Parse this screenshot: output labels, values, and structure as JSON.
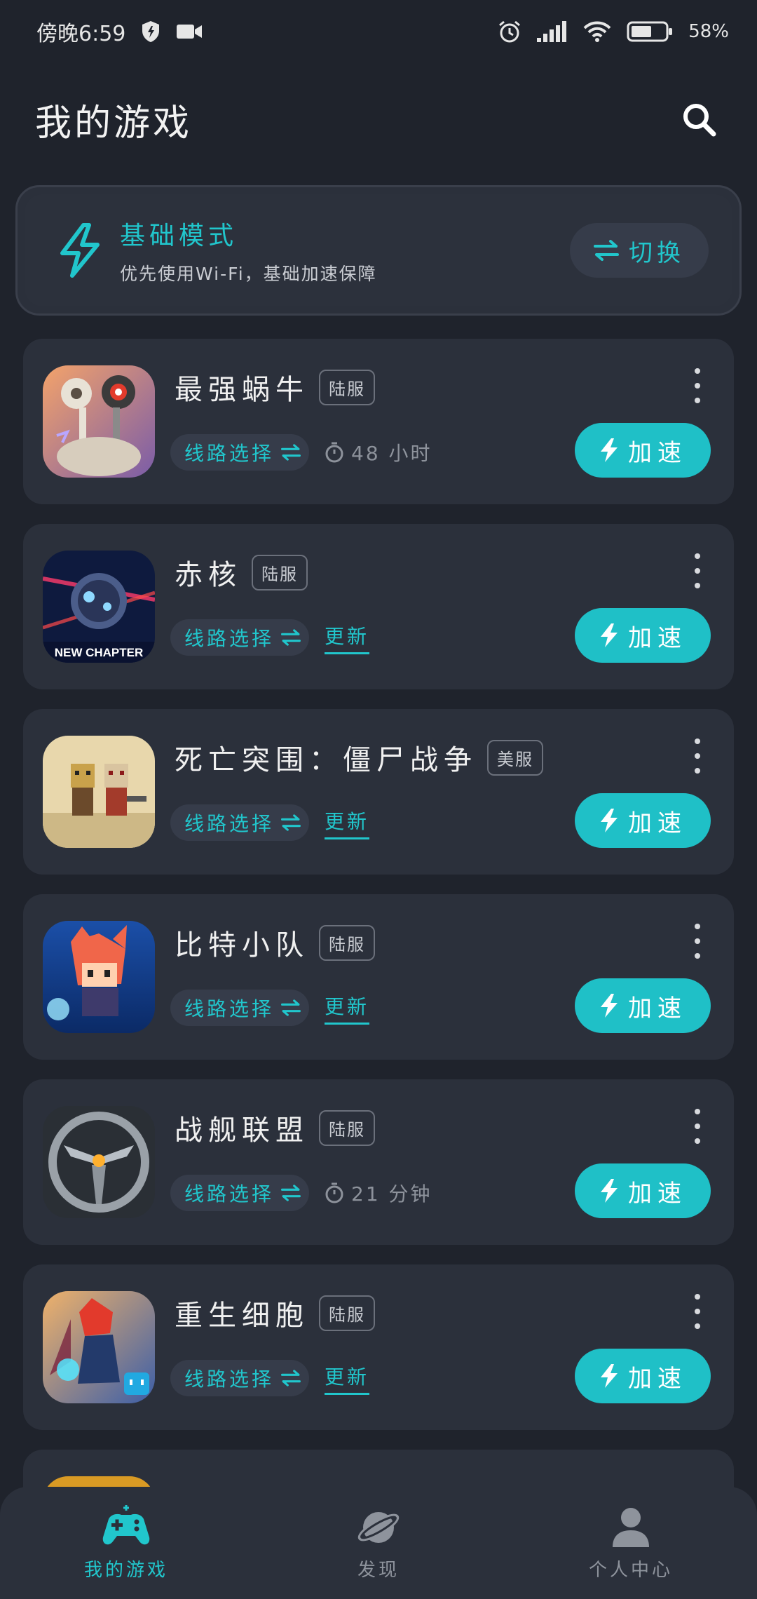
{
  "status_bar": {
    "time": "傍晚6:59",
    "battery": "58%"
  },
  "header": {
    "title": "我的游戏"
  },
  "mode": {
    "title": "基础模式",
    "subtitle": "优先使用Wi-Fi，基础加速保障",
    "switch_label": "切换"
  },
  "games": [
    {
      "name": "最强蜗牛",
      "server": "陆服",
      "route_label": "线路选择",
      "time": "48 小时",
      "update": "",
      "accel_label": "加速"
    },
    {
      "name": "赤核",
      "server": "陆服",
      "route_label": "线路选择",
      "time": "",
      "update": "更新",
      "accel_label": "加速",
      "icon_caption": "NEW CHAPTER"
    },
    {
      "name": "死亡突围：僵尸战争",
      "server": "美服",
      "route_label": "线路选择",
      "time": "",
      "update": "更新",
      "accel_label": "加速"
    },
    {
      "name": "比特小队",
      "server": "陆服",
      "route_label": "线路选择",
      "time": "",
      "update": "更新",
      "accel_label": "加速"
    },
    {
      "name": "战舰联盟",
      "server": "陆服",
      "route_label": "线路选择",
      "time": "21 分钟",
      "update": "",
      "accel_label": "加速"
    },
    {
      "name": "重生细胞",
      "server": "陆服",
      "route_label": "线路选择",
      "time": "",
      "update": "更新",
      "accel_label": "加速"
    }
  ],
  "nav": {
    "items": [
      {
        "label": "我的游戏",
        "icon": "gamepad-icon",
        "active": true
      },
      {
        "label": "发现",
        "icon": "planet-icon",
        "active": false
      },
      {
        "label": "个人中心",
        "icon": "person-icon",
        "active": false
      }
    ]
  },
  "colors": {
    "accent": "#1fc0c7",
    "background": "#1f232c",
    "card": "#2b303b"
  }
}
